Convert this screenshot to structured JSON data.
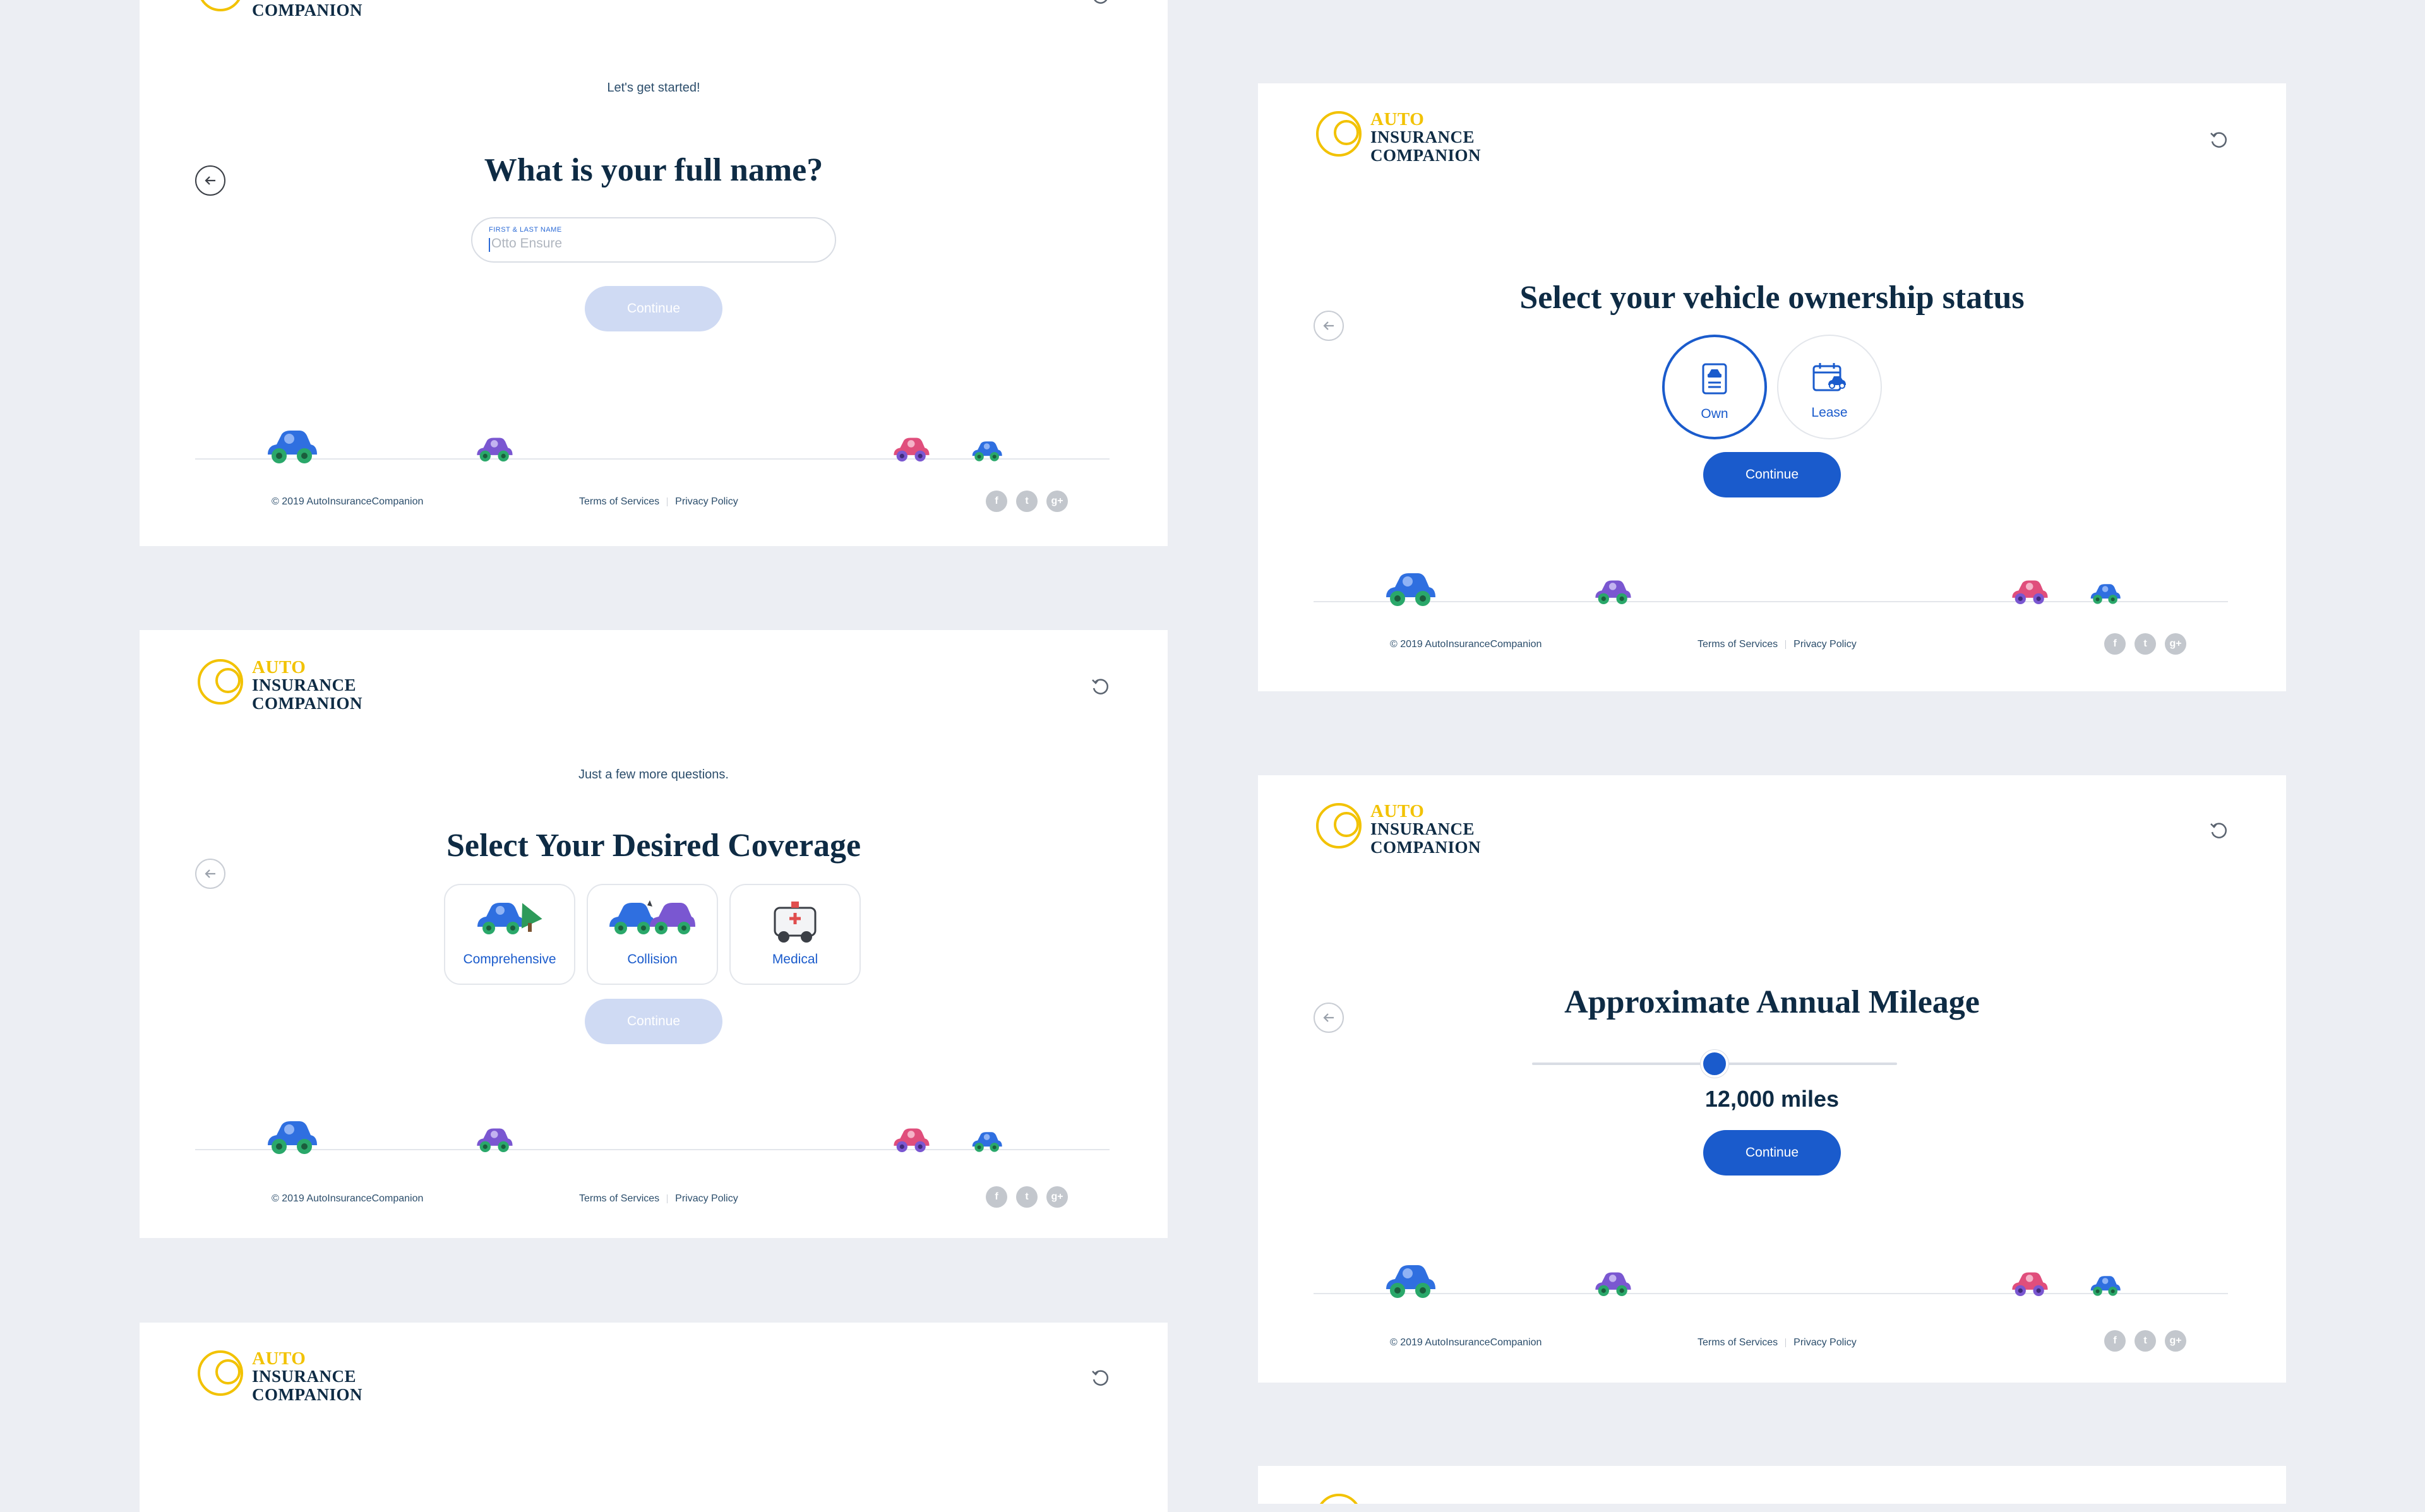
{
  "brand": {
    "auto": "AUTO",
    "insurance": "INSURANCE",
    "companion": "COMPANION"
  },
  "name_screen": {
    "subtitle": "Let's get started!",
    "heading": "What is your full name?",
    "field_label": "FIRST & LAST NAME",
    "field_placeholder": "Otto Ensure",
    "continue_label": "Continue"
  },
  "ownership_screen": {
    "heading": "Select your vehicle ownership status",
    "options": [
      {
        "label": "Own",
        "icon": "document-car-icon",
        "selected": true
      },
      {
        "label": "Lease",
        "icon": "calendar-car-icon",
        "selected": false
      }
    ],
    "continue_label": "Continue"
  },
  "coverage_screen": {
    "subtitle": "Just a few more questions.",
    "heading": "Select Your Desired Coverage",
    "options": [
      {
        "label": "Comprehensive",
        "icon": "car-tree-icon"
      },
      {
        "label": "Collision",
        "icon": "car-collision-icon"
      },
      {
        "label": "Medical",
        "icon": "ambulance-icon"
      }
    ],
    "continue_label": "Continue"
  },
  "mileage_screen": {
    "heading": "Approximate Annual Mileage",
    "value_label": "12,000 miles",
    "slider_fraction": 0.5,
    "continue_label": "Continue"
  },
  "footer": {
    "copyright": "© 2019 AutoInsuranceCompanion",
    "terms": "Terms of Services",
    "privacy": "Privacy Policy",
    "social": [
      {
        "icon": "facebook-icon",
        "glyph": "f"
      },
      {
        "icon": "twitter-icon",
        "glyph": "t"
      },
      {
        "icon": "google-plus-icon",
        "glyph": "g+"
      }
    ]
  },
  "colors": {
    "primary": "#1a5bcc",
    "disabled": "#cfdaf3",
    "navy": "#0e2b44",
    "gold": "#f2c200",
    "background": "#eceef3"
  }
}
